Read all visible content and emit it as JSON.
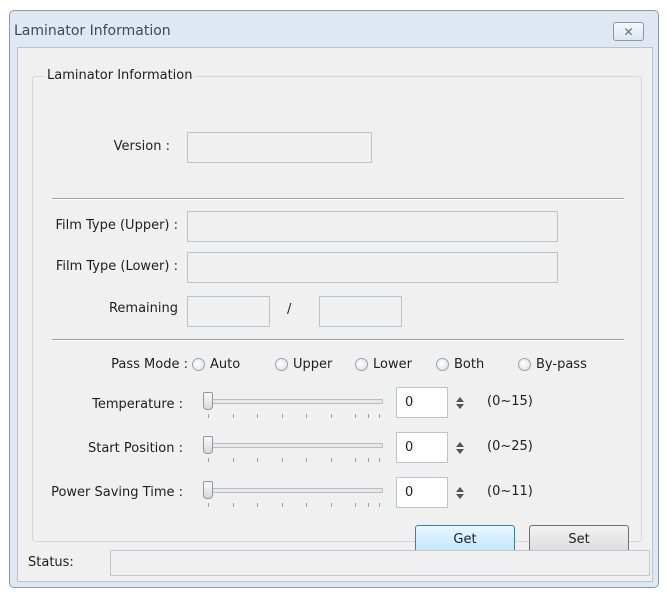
{
  "window": {
    "title": "Laminator Information",
    "close_glyph": "✕",
    "accent_colors": {
      "titlebar": "#dfe8f2",
      "client_bg": "#f0f0f0",
      "primary_button": "#bee6fd"
    }
  },
  "group": {
    "legend": "Laminator Information",
    "version_label": "Version :",
    "version_value": "",
    "film_upper_label": "Film Type (Upper) :",
    "film_upper_value": "",
    "film_lower_label": "Film Type (Lower) :",
    "film_lower_value": "",
    "remaining_label": "Remaining",
    "remaining_left": "",
    "remaining_slash": "/",
    "remaining_right": ""
  },
  "pass_mode": {
    "label": "Pass Mode :",
    "options": [
      "Auto",
      "Upper",
      "Lower",
      "Both",
      "By-pass"
    ]
  },
  "settings": [
    {
      "label": "Temperature :",
      "value": "0",
      "range": "(0~15)"
    },
    {
      "label": "Start Position :",
      "value": "0",
      "range": "(0~25)"
    },
    {
      "label": "Power Saving Time :",
      "value": "0",
      "range": "(0~11)"
    }
  ],
  "buttons": {
    "get": "Get",
    "set": "Set"
  },
  "status": {
    "label": "Status:",
    "value": ""
  }
}
